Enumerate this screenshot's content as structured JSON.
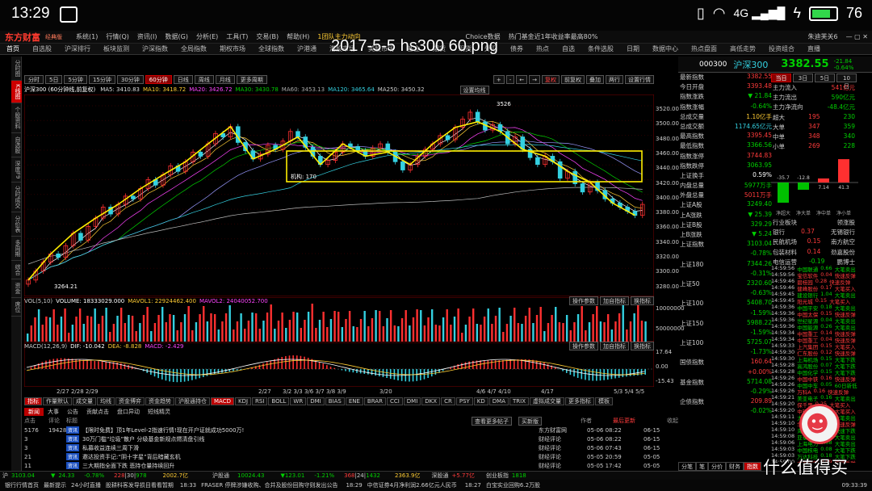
{
  "status_bar": {
    "time": "13:29",
    "battery": "76"
  },
  "app": {
    "logo": "东方财富",
    "logo_sub": "经典版",
    "menu": [
      "系统(1)",
      "行情(Q)",
      "资讯(I)",
      "数据(G)",
      "分析(E)",
      "工具(T)",
      "交易(B)",
      "帮助(H)"
    ],
    "ticker_hint": "1团队主力动向",
    "ticker_hint2": "Choice数据",
    "ticker_hint3": "热门基金近1年收益率最高80%",
    "user": "朱迪芙关6"
  },
  "nav": [
    "首页",
    "自选股",
    "沪深排行",
    "板块监测",
    "沪深指数",
    "全局指数",
    "期权市场",
    "全球指数",
    "沪港通",
    "港股市场",
    "美股市场",
    "基金",
    "期货",
    "现货",
    "外汇",
    "债券",
    "热点",
    "自选",
    "条件选股",
    "日期",
    "数据中心",
    "热点盘面",
    "高低走势",
    "投资组合",
    "直播"
  ],
  "overlay_title": "2017-5-5  hs300 60.png",
  "left_tabs": [
    "分时图",
    "K线图",
    "个股资料",
    "自选股",
    "深度F9",
    "分时成交",
    "分价表",
    "多周期",
    "综合",
    "资金",
    "席位"
  ],
  "chart_toolbar": {
    "periods": [
      "分时",
      "5日",
      "5分钟",
      "15分钟",
      "30分钟",
      "60分钟",
      "日线",
      "周线",
      "月线",
      "更多周期"
    ],
    "selected_period": "60分钟",
    "right_buttons": [
      "复权",
      "前复权",
      "叠加",
      "两行",
      "设置行情"
    ]
  },
  "ma_line": {
    "name": "沪深300 (60分钟线,前复权)",
    "ma5": "MA5: 3410.83",
    "ma10": "MA10: 3418.72",
    "ma20": "MA20: 3426.72",
    "ma30": "MA30: 3430.78",
    "ma60": "MA60: 3453.13",
    "ma120": "MA120: 3465.64",
    "ma250": "MA250: 3450.32",
    "setting": "设置均线"
  },
  "main_axis": [
    "3520.00",
    "3500.00",
    "3480.00",
    "3460.00",
    "3440.00",
    "3420.00",
    "3400.00",
    "3380.00",
    "3360.00",
    "3340.00",
    "3320.00",
    "3300.00",
    "3280.00"
  ],
  "annotations": {
    "high": "3526",
    "low": "3264.21",
    "box_left": "机构: 170"
  },
  "volume": {
    "label": "VOL(5,10)",
    "volume": "VOLUME: 18333029.000",
    "mavol1": "MAVOL1: 22924462.400",
    "mavol2": "MAVOL2: 24040052.700",
    "buttons": [
      "操作参数",
      "加自指标",
      "换指标"
    ],
    "axis": [
      "10000000",
      "50000000"
    ]
  },
  "macd": {
    "label": "MACD(12,26,9)",
    "dif": "DIF: -10.042",
    "dea": "DEA: -8.828",
    "macd": "MACD: -2.429",
    "buttons": [
      "操作参数",
      "加自指标",
      "换指标"
    ],
    "axis": [
      "17.64",
      "0.00",
      "-15.43"
    ]
  },
  "date_axis": [
    "2/27 2/28 2/29",
    "2/27",
    "3/2 3/3 3/6 3/7 3/8 3/9",
    "3/20",
    "4/6 4/7 4/10",
    "4/17",
    "5/3 5/4 5/5"
  ],
  "indicator_tabs": [
    "指标",
    "作量默认",
    "成交量",
    "均线",
    "资金博弈",
    "资金趋势",
    "沪股通持仓",
    "MACD",
    "KDJ",
    "RSI",
    "BOLL",
    "WR",
    "DMI",
    "BIAS",
    "ENE",
    "BRAR",
    "CCI",
    "DMI",
    "DKX",
    "CR",
    "PSY",
    "KD",
    "DMA",
    "TRIX",
    "虚拟成交量",
    "更多指标",
    "模板"
  ],
  "news_tabs": [
    "新闻",
    "大事",
    "公告",
    "贡献点击",
    "盘口异动",
    "短线精灵"
  ],
  "news_header": {
    "c1": "点击",
    "c2": "评论",
    "c3": "标题",
    "btn1": "查看更多帖子",
    "btn2": "买新版",
    "author": "作者",
    "latest": "最后更新",
    "collapse": "收起"
  },
  "news": [
    {
      "n1": "5176",
      "n2": "19428",
      "title": "【限时免费】顶1年Level-2指速行情!现在开户证就成功5000万!",
      "src": "东方财富网",
      "date": "05-06 08:22",
      "date2": "06-15"
    },
    {
      "n1": "3",
      "n2": "",
      "title": "30万门槛“垃圾”散户 分级基金新规点燃清盘引线",
      "src": "财经评论",
      "date": "05-06 08:22",
      "date2": "06-15"
    },
    {
      "n1": "3",
      "n2": "",
      "title": "私募收益连续三周下滑",
      "src": "财经评论",
      "date": "05-06 07:43",
      "date2": "06-15"
    },
    {
      "n1": "21",
      "n2": "",
      "title": "邀达投资手记:“阴十字星”背后暗藏玄机",
      "src": "财经评论",
      "date": "05-05 20:59",
      "date2": "05-05"
    },
    {
      "n1": "11",
      "n2": "",
      "title": "三大期指全面下跌 悲持仓量持续回升",
      "src": "财经评论",
      "date": "05-05 17:42",
      "date2": "05-05"
    }
  ],
  "bottom_bar": {
    "sh": "3103.04",
    "sh_chg": "24.33",
    "sh_pct": "-0.78%",
    "sh_amt": "228",
    "sh_amt2": "30",
    "sh_amt3": "978",
    "amt": "2002.7亿",
    "hg": "沪股通",
    "hg_val": "10024.43",
    "hg_chg": "123.01",
    "hg_pct": "-1.21%",
    "hg_up": "368",
    "hg_dn": "24",
    "hg_dn2": "1432",
    "hg_amt": "2363.9亿",
    "sz": "深股通",
    "sz_chg": "+5.77亿",
    "sz_val": "1018",
    "chuang": "创业板指",
    "chuang_val": "1818"
  },
  "bottom_bar2": {
    "scroll": "银行行情首页",
    "scroll2": "最新提示",
    "scroll3": "24小时直播",
    "news1": "股耕科客发导损目看看暂期",
    "time1": "18:33",
    "news2": "FRASER 停牌涉嫌收购、合并及股份回购守则发出公告",
    "time2": "18:29",
    "news3": "中信证券4月净利润2.66亿元人民币",
    "time3": "18:27",
    "news4": "白宝实业回购6.2万股",
    "time4": "09:33:39"
  },
  "right_head": {
    "code": "000300",
    "name": "沪深300",
    "price": "3382.55",
    "chg": "-21.84",
    "pct": "-0.64%",
    "tabs": [
      "当日",
      "3日",
      "5日",
      "10日"
    ]
  },
  "right_quote": [
    {
      "k": "最新指数",
      "v": "3382.55",
      "c": "red"
    },
    {
      "k": "今日开盘",
      "v": "3393.48",
      "c": "red"
    },
    {
      "k": "指数涨跌",
      "v": "▼ 21.84",
      "c": "green"
    },
    {
      "k": "指数涨幅",
      "v": "-0.64%",
      "c": "green"
    },
    {
      "k": "总成交量",
      "v": "1.10亿手",
      "c": "yellow"
    },
    {
      "k": "总成交额",
      "v": "1174.65亿元",
      "c": "cyan"
    },
    {
      "k": "最高指数",
      "v": "3395.45",
      "c": "red"
    },
    {
      "k": "最低指数",
      "v": "3366.56",
      "c": "green"
    },
    {
      "k": "指数涨停",
      "v": "3744.83",
      "c": "red"
    },
    {
      "k": "指数跌停",
      "v": "3063.95",
      "c": "green"
    },
    {
      "k": "上证换手",
      "v": "0.59%",
      "c": "white"
    },
    {
      "k": "内盘总量",
      "v": "5977万手",
      "c": "green"
    },
    {
      "k": "外盘总量",
      "v": "5011万手",
      "c": "red"
    },
    {
      "k": "上证A股",
      "v": "3249.40",
      "c": "green"
    },
    {
      "k": "上A涨跌",
      "v": "▼ 25.39",
      "c": "green"
    },
    {
      "k": "上证B股",
      "v": "329.29",
      "c": "green"
    },
    {
      "k": "上B涨跌",
      "v": "▼ 5.24",
      "c": "green"
    },
    {
      "k": "上证指数",
      "v": "3103.04",
      "c": "green"
    },
    {
      "k": "",
      "v": "-0.78%",
      "c": "green"
    },
    {
      "k": "上证180",
      "v": "7344.26",
      "c": "green"
    },
    {
      "k": "",
      "v": "-0.31%",
      "c": "green"
    },
    {
      "k": "上证50",
      "v": "2320.60",
      "c": "green"
    },
    {
      "k": "",
      "v": "-0.63%",
      "c": "green"
    },
    {
      "k": "上证100",
      "v": "5408.70",
      "c": "green"
    },
    {
      "k": "",
      "v": "-1.59%",
      "c": "green"
    },
    {
      "k": "上证150",
      "v": "5988.22",
      "c": "green"
    },
    {
      "k": "",
      "v": "-1.59%",
      "c": "green"
    },
    {
      "k": "上证100",
      "v": "5725.07",
      "c": "green"
    },
    {
      "k": "",
      "v": "-1.73%",
      "c": "green"
    },
    {
      "k": "国债指数",
      "v": "160.64",
      "c": "red"
    },
    {
      "k": "",
      "v": "+0.00%",
      "c": "red"
    },
    {
      "k": "基金指数",
      "v": "5714.08",
      "c": "green"
    },
    {
      "k": "",
      "v": "-0.29%",
      "c": "green"
    },
    {
      "k": "企债指数",
      "v": "209.89",
      "c": "red"
    },
    {
      "k": "",
      "v": "-0.02%",
      "c": "green"
    }
  ],
  "flow": {
    "headers": [
      "主力流入",
      "主力流出",
      "主力净流向",
      "(亿元)",
      "超大",
      "大单",
      "中单",
      "小单"
    ],
    "values": [
      {
        "k": "主力流入",
        "v": "541亿元",
        "c": "red"
      },
      {
        "k": "主力流出",
        "v": "590亿元",
        "c": "green"
      },
      {
        "k": "主力净流向",
        "v": "-48.4亿元",
        "c": "green"
      }
    ],
    "table": [
      {
        "k": "超大",
        "a": "195",
        "b": "230"
      },
      {
        "k": "大单",
        "a": "347",
        "b": "359"
      },
      {
        "k": "中单",
        "a": "348",
        "b": "340"
      },
      {
        "k": "小单",
        "a": "269",
        "b": "228"
      }
    ],
    "bars": [
      {
        "label": "-35.7",
        "value": -35.7
      },
      {
        "label": "-12.8",
        "value": -12.8
      },
      {
        "label": "7.14",
        "value": 7.14
      },
      {
        "label": "41.3",
        "value": 41.3
      }
    ],
    "bar_labels": [
      "净超大",
      "净大单",
      "净中单",
      "净小单"
    ]
  },
  "sectors": {
    "headers": [
      "行业板块",
      "领涨股"
    ],
    "rows": [
      {
        "k": "银行",
        "v": "0.37",
        "s": "无锡银行"
      },
      {
        "k": "民航机场",
        "v": "0.15",
        "s": "南方航空"
      },
      {
        "k": "包装材料",
        "v": "0.14",
        "s": "劲嘉股份"
      },
      {
        "k": "电信运营",
        "v": "-0.19",
        "s": "鹏博士"
      }
    ]
  },
  "ticks": [
    [
      "14:59:56",
      "中国联通",
      "0.66",
      "大笔卖出"
    ],
    [
      "14:59:56",
      "宝信软件",
      "0.04",
      "快速反弹"
    ],
    [
      "14:59:46",
      "碧桂园",
      "0.28",
      "快速反弹"
    ],
    [
      "14:59:46",
      "健峰股份",
      "0.17",
      "大笔买入"
    ],
    [
      "14:59:45",
      "建设银行",
      "1.04",
      "大笔卖出"
    ],
    [
      "14:59:45",
      "阳光城",
      "0.15",
      "大笔买入"
    ],
    [
      "14:59:36",
      "中国平安",
      "0.18",
      "大笔卖出"
    ],
    [
      "14:59:36",
      "中国太保",
      "0.15",
      "快速反弹"
    ],
    [
      "14:59:36",
      "世纪星源",
      "0.04",
      "大笔卖出"
    ],
    [
      "14:59:36",
      "中国能源",
      "0.26",
      "大笔卖出"
    ],
    [
      "14:59:34",
      "中国重工",
      "0.14",
      "快速反弹"
    ],
    [
      "14:59:34",
      "中国重工",
      "0.04",
      "快速反弹"
    ],
    [
      "14:59:33",
      "上汽集团",
      "0.15",
      "大笔买入"
    ],
    [
      "14:59:30",
      "仁东股份",
      "0.12",
      "快速反弹"
    ],
    [
      "14:59:30",
      "上海机场",
      "0.15",
      "大笔下跌"
    ],
    [
      "14:59:28",
      "高鸿股份",
      "0.07",
      "大笔下跌"
    ],
    [
      "14:59:28",
      "中国化学",
      "0.15",
      "大笔下跌"
    ],
    [
      "14:59:26",
      "中国中铁",
      "0.16",
      "快速反弹"
    ],
    [
      "14:59:26",
      "中国中车",
      "0.05",
      "60日新低"
    ],
    [
      "14:59:26",
      "万科A",
      "0.16",
      "快速反弹"
    ],
    [
      "14:59:21",
      "美亚电子",
      "0.16",
      "大笔卖出"
    ],
    [
      "14:59:20",
      "保千里",
      "0.25",
      "大笔买入"
    ],
    [
      "14:59:20",
      "中环股份",
      "0.21",
      "大笔买入"
    ],
    [
      "14:59:11",
      "大金重工",
      "0.18",
      "大笔卖出"
    ],
    [
      "14:59:10",
      "华锋股份",
      "0.18",
      "快速反弹"
    ],
    [
      "14:59:10",
      "海螺型材",
      "0.15",
      "快速下跌"
    ],
    [
      "14:59:08",
      "亚泰集团",
      "0.13",
      "大笔卖出"
    ],
    [
      "14:59:06",
      "上海电力",
      "0.08",
      "大笔卖出"
    ],
    [
      "14:59:03",
      "中国核电",
      "0.08",
      "大笔下跌"
    ],
    [
      "14:59:03",
      "万达科技",
      "0.18",
      "大笔下跌"
    ],
    [
      "14:59:00",
      "中泰化学",
      "0.09",
      "快速反弹"
    ],
    [
      "14:59:00",
      "海立股份",
      "0.10",
      "大笔卖出"
    ]
  ],
  "right_bottom_tabs": [
    "分笔",
    "笔",
    "分价",
    "财务",
    "指数"
  ],
  "watermark": "什么值得买",
  "chart_data": {
    "type": "candlestick",
    "title": "沪深300 (60分钟线,前复权)",
    "ylim": [
      3260,
      3530
    ],
    "values": [
      3272,
      3285,
      3298,
      3310,
      3305,
      3322,
      3340,
      3330,
      3350,
      3362,
      3378,
      3368,
      3382,
      3394,
      3390,
      3405,
      3418,
      3410,
      3425,
      3438,
      3430,
      3444,
      3458,
      3452,
      3470,
      3485,
      3480,
      3495,
      3472,
      3460,
      3448,
      3455,
      3468,
      3462,
      3474,
      3488,
      3480,
      3465,
      3452,
      3440,
      3446,
      3458,
      3470,
      3466,
      3460,
      3452,
      3464,
      3470,
      3458,
      3444,
      3432,
      3440,
      3452,
      3462,
      3470,
      3482,
      3476,
      3494,
      3506,
      3516,
      3502,
      3490,
      3498,
      3488,
      3470,
      3480,
      3462,
      3450,
      3440,
      3452,
      3444,
      3420,
      3430,
      3412,
      3400,
      3414,
      3402,
      3390,
      3384,
      3378,
      3372,
      3366,
      3382
    ],
    "ma_lines": [
      "MA5",
      "MA10",
      "MA20",
      "MA30",
      "MA60",
      "MA120",
      "MA250"
    ]
  }
}
